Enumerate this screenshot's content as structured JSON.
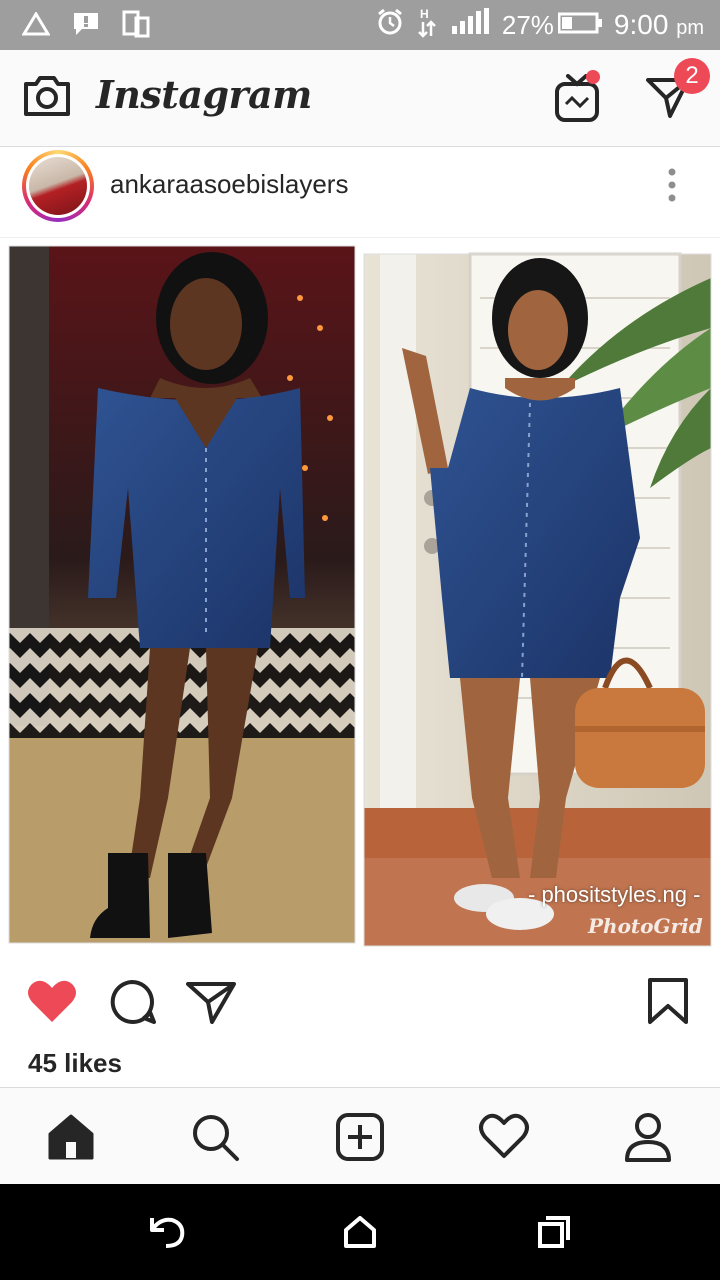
{
  "status_bar": {
    "battery": "27%",
    "time": "9:00",
    "ampm": "pm",
    "icons": [
      "drive-icon",
      "alert-icon",
      "sim-icon",
      "alarm-icon",
      "data-arrows-icon",
      "signal-icon",
      "battery-icon"
    ]
  },
  "header": {
    "logo": "Instagram",
    "dm_badge": "2",
    "icons": [
      "camera-icon",
      "igtv-icon",
      "direct-message-icon"
    ]
  },
  "post": {
    "username": "ankaraasoebislayers",
    "image_caption_watermark": "- phositstyles.ng -",
    "image_app_watermark": "PhotoGrid",
    "likes": "45 likes",
    "liked": true
  },
  "bottom_nav": {
    "items": [
      "home-icon",
      "search-icon",
      "new-post-icon",
      "activity-icon",
      "profile-icon"
    ]
  },
  "android_nav": {
    "items": [
      "back-icon",
      "home-icon",
      "recents-icon"
    ]
  },
  "colors": {
    "status_bar": "#9e9e9e",
    "like_red": "#ed4956",
    "denim": "#27467f"
  }
}
